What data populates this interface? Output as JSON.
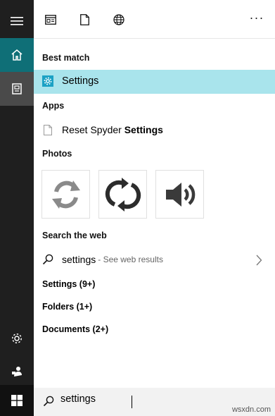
{
  "topbar": {
    "more_label": "···"
  },
  "results": {
    "best_match_heading": "Best match",
    "best_match_label": "Settings",
    "apps_heading": "Apps",
    "app_item_prefix": "Reset Spyder ",
    "app_item_bold": "Settings",
    "photos_heading": "Photos",
    "web_heading": "Search the web",
    "web_query": "settings",
    "web_sub": "- See web results",
    "settings_count": "Settings (9+)",
    "folders_count": "Folders (1+)",
    "documents_count": "Documents (2+)"
  },
  "search": {
    "value": "settings"
  },
  "watermark": "wsxdn.com",
  "colors": {
    "rail_bg": "#1f1f1f",
    "home_active": "#0f6f77",
    "selected_row": "#a9e4ec",
    "settings_icon": "#1ba1c4"
  }
}
